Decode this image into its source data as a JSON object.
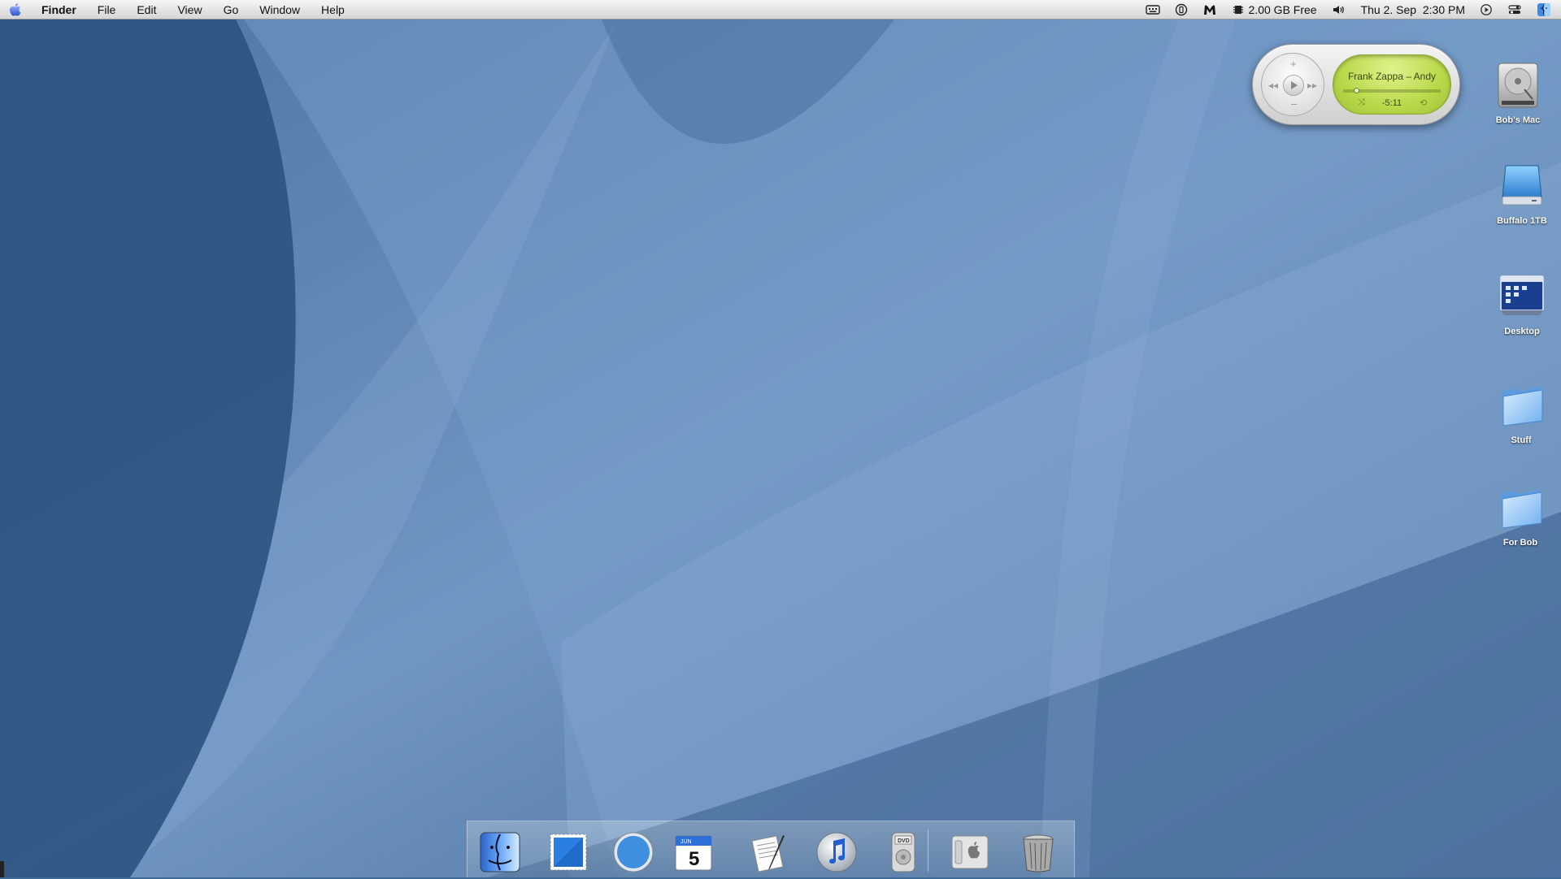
{
  "menubar": {
    "apple_icon": "apple-icon",
    "app_name": "Finder",
    "menus": [
      "File",
      "Edit",
      "View",
      "Go",
      "Window",
      "Help"
    ],
    "status": {
      "memory_free": "2.00 GB Free",
      "datetime": "Thu 2. Sep  2:30 PM",
      "icons": [
        "keyboard-icon",
        "timer-icon",
        "malwarebytes-icon",
        "memory-chip-icon",
        "volume-icon",
        "play-circle-icon",
        "control-switch-icon",
        "finder-face-icon"
      ]
    }
  },
  "itunes_widget": {
    "track": "Frank Zappa – Andy",
    "time_remaining": "-5:11",
    "progress_fraction": 0.14,
    "buttons": [
      "volume-up",
      "previous",
      "play",
      "next",
      "volume-down"
    ],
    "lcd_colors": {
      "lcd": "#b9d84a",
      "text": "#3a4a12"
    }
  },
  "desktop_icons": [
    {
      "label": "Bob's Mac",
      "icon": "hard-drive-icon"
    },
    {
      "label": "Buffalo 1TB",
      "icon": "external-drive-icon"
    },
    {
      "label": "Desktop",
      "icon": "desktop-folder-icon"
    },
    {
      "label": "Stuff",
      "icon": "folder-icon"
    },
    {
      "label": "For Bob",
      "icon": "folder-icon"
    }
  ],
  "dock": {
    "items": [
      "finder-icon",
      "mail-icon",
      "safari-icon",
      "ical-icon",
      "textedit-icon",
      "itunes-icon",
      "dvd-player-icon",
      "system-preferences-icon",
      "trash-icon"
    ],
    "ical_date": {
      "month": "JUN",
      "day": "5"
    }
  },
  "colors": {
    "wallpaper_dark": "#2c5582",
    "wallpaper_light": "#86a8d0",
    "menubar": "#e6e6e6"
  }
}
